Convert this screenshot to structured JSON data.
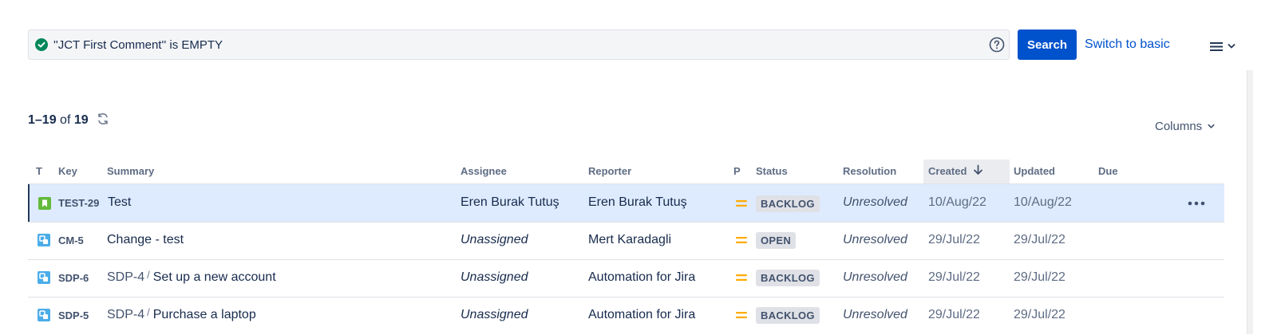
{
  "search": {
    "jql": "''JCT First Comment'' is EMPTY",
    "search_label": "Search",
    "switch_label": "Switch to basic"
  },
  "results": {
    "range": "1–19",
    "of_label": "of",
    "total": "19"
  },
  "columns_label": "Columns",
  "table": {
    "headers": {
      "type": "T",
      "key": "Key",
      "summary": "Summary",
      "assignee": "Assignee",
      "reporter": "Reporter",
      "priority": "P",
      "status": "Status",
      "resolution": "Resolution",
      "created": "Created",
      "updated": "Updated",
      "due": "Due"
    },
    "rows": [
      {
        "type_icon": "story-icon",
        "key": "TEST-29",
        "parent": "",
        "summary": "Test",
        "assignee": "Eren Burak Tutuş",
        "reporter": "Eren Burak Tutuş",
        "priority_icon": "priority-medium-icon",
        "status": "BACKLOG",
        "resolution": "Unresolved",
        "created": "10/Aug/22",
        "updated": "10/Aug/22",
        "due": ""
      },
      {
        "type_icon": "subtask-icon",
        "key": "CM-5",
        "parent": "",
        "summary": "Change - test",
        "assignee": "Unassigned",
        "reporter": "Mert Karadagli",
        "priority_icon": "priority-medium-icon",
        "status": "OPEN",
        "resolution": "Unresolved",
        "created": "29/Jul/22",
        "updated": "29/Jul/22",
        "due": ""
      },
      {
        "type_icon": "subtask-icon",
        "key": "SDP-6",
        "parent": "SDP-4",
        "summary": "Set up a new account",
        "assignee": "Unassigned",
        "reporter": "Automation for Jira",
        "priority_icon": "priority-medium-icon",
        "status": "BACKLOG",
        "resolution": "Unresolved",
        "created": "29/Jul/22",
        "updated": "29/Jul/22",
        "due": ""
      },
      {
        "type_icon": "subtask-icon",
        "key": "SDP-5",
        "parent": "SDP-4",
        "summary": "Purchase a laptop",
        "assignee": "Unassigned",
        "reporter": "Automation for Jira",
        "priority_icon": "priority-medium-icon",
        "status": "BACKLOG",
        "resolution": "Unresolved",
        "created": "29/Jul/22",
        "updated": "29/Jul/22",
        "due": ""
      }
    ]
  },
  "colors": {
    "primary": "#0052cc",
    "valid": "#00875a",
    "story": "#63ba3c",
    "subtask": "#4bade8",
    "priority_medium": "#ffab00",
    "selected_row": "#deebff"
  }
}
